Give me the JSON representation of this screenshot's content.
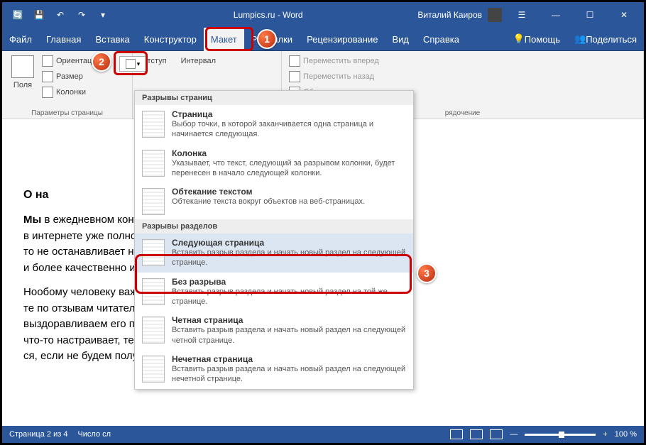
{
  "titlebar": {
    "title": "Lumpics.ru - Word",
    "user": "Виталий Каиров"
  },
  "tabs": {
    "file": "Файл",
    "home": "Главная",
    "insert": "Вставка",
    "design": "Конструктор",
    "layout": "Макет",
    "references": "Рассылки",
    "review": "Рецензирование",
    "view": "Вид",
    "help": "Справка",
    "assist": "Помощь",
    "share": "Поделиться"
  },
  "ribbon": {
    "margins": "Поля",
    "orientation": "Ориентация",
    "size": "Размер",
    "columns": "Колонки",
    "page_setup_label": "Параметры страницы",
    "indent": "Отступ",
    "spacing": "Интервал",
    "bring_forward": "Переместить вперед",
    "send_backward": "Переместить назад",
    "selection_pane": "Область выделения",
    "arrange_label": "рядочение"
  },
  "dropdown": {
    "section1": "Разрывы страниц",
    "page": {
      "t": "Страница",
      "d": "Выбор точки, в которой заканчивается одна страница и начинается следующая."
    },
    "column": {
      "t": "Колонка",
      "d": "Указывает, что текст, следующий за разрывом колонки, будет перенесен в начало следующей колонки."
    },
    "wrap": {
      "t": "Обтекание текстом",
      "d": "Обтекание текста вокруг объектов на веб-страницах."
    },
    "section2": "Разрывы разделов",
    "next": {
      "t": "Следующая страница",
      "d": "Вставить разрыв раздела и начать новый раздел на следующей странице."
    },
    "cont": {
      "t": "Без разрыва",
      "d": "Вставить разрыв раздела и начать новый раздел на той же странице."
    },
    "even": {
      "t": "Четная страница",
      "d": "Вставить разрыв раздела и начать новый раздел на следующей четной странице."
    },
    "odd": {
      "t": "Нечетная страница",
      "d": "Вставить разрыв раздела и начать новый раздел на следующей нечетной странице."
    }
  },
  "document": {
    "heading": "О на",
    "p1a": "Мы",
    "p1b": " в ежедневном контакте с ком",
    "p1c": " в интернете уже полно инф",
    "p1d": "то не останавливает нас, что",
    "p1e": "и более качественно и бы",
    "p2a": "Но",
    "p2b": "обому человеку важно знать, что",
    "p2c": "те по отзывам читателей. Дон",
    "p2d": " выздоравливаем его паци",
    "p2e": " что-то настраивает, тем он кач",
    "p2f": "ся, если не будем получать"
  },
  "status": {
    "page": "Страница 2 из 4",
    "words": "Число сл",
    "zoom": "100 %"
  },
  "badges": {
    "one": "1",
    "two": "2",
    "three": "3"
  }
}
